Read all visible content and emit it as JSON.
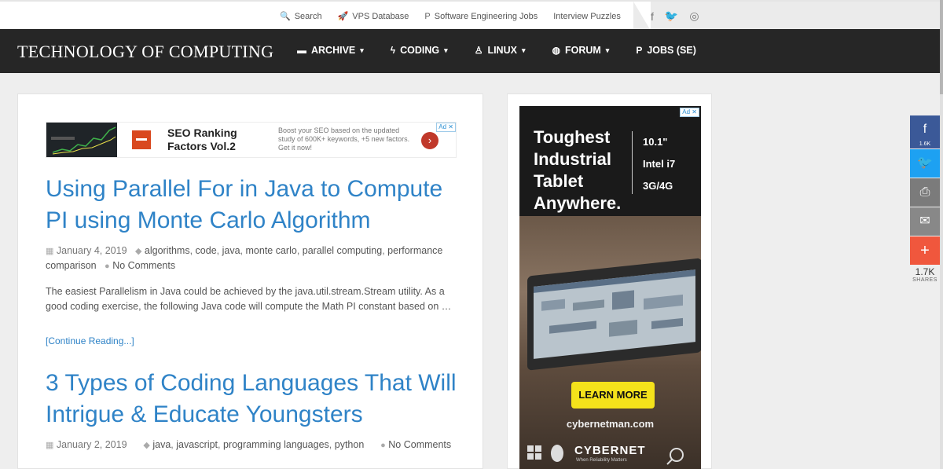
{
  "topbar": {
    "links": [
      {
        "icon": "search-icon",
        "glyph": "🔍",
        "label": "Search"
      },
      {
        "icon": "rocket-icon",
        "glyph": "🚀",
        "label": "VPS Database"
      },
      {
        "icon": "p-icon",
        "glyph": "P",
        "label": "Software Engineering Jobs"
      },
      {
        "icon": "none",
        "glyph": "",
        "label": "Interview Puzzles"
      }
    ],
    "social": [
      {
        "icon": "facebook-icon",
        "glyph": "f"
      },
      {
        "icon": "twitter-icon",
        "glyph": "🐦"
      },
      {
        "icon": "rss-icon",
        "glyph": "◎"
      }
    ]
  },
  "nav": {
    "brand": "TECHNOLOGY OF COMPUTING",
    "items": [
      {
        "icon": "archive-icon",
        "glyph": "▬",
        "label": "ARCHIVE"
      },
      {
        "icon": "bolt-icon",
        "glyph": "ϟ",
        "label": "CODING"
      },
      {
        "icon": "linux-icon",
        "glyph": "♙",
        "label": "LINUX"
      },
      {
        "icon": "forum-icon",
        "glyph": "◍",
        "label": "FORUM"
      },
      {
        "icon": "p-icon",
        "glyph": "P",
        "label": "JOBS (SE)"
      }
    ],
    "caret": "▾"
  },
  "ad_banner": {
    "title": "SEO Ranking Factors Vol.2",
    "desc": "Boost your SEO based on the updated study of 600K+ keywords, +5 new factors. Get it now!",
    "go": "›",
    "adchoice": "Ad ✕"
  },
  "posts": [
    {
      "title": "Using Parallel For in Java to Compute PI using Monte Carlo Algorithm",
      "date": "January 4, 2019",
      "tags": [
        "algorithms",
        "code",
        "java",
        "monte carlo",
        "parallel computing",
        "performance comparison"
      ],
      "comments": "No Comments",
      "excerpt": "The easiest Parallelism in Java could be achieved by the java.util.stream.Stream utility. As a good coding exercise, the following Java code will compute the Math PI constant based on …",
      "read_more": "[Continue Reading...]"
    },
    {
      "title": "3 Types of Coding Languages That Will Intrigue & Educate Youngsters",
      "date": "January 2, 2019",
      "tags": [
        "java",
        "javascript",
        "programming languages",
        "python"
      ],
      "comments": "No Comments"
    }
  ],
  "sidebar_ad": {
    "headline": "Toughest Industrial Tablet Anywhere.",
    "specs": [
      "10.1\"",
      "Intel i7",
      "3G/4G"
    ],
    "cta": "LEARN MORE",
    "site": "cybernetman.com",
    "brand": "CYBERNET",
    "slogan": "When Reliability Matters",
    "adchoice": "Ad ✕"
  },
  "share": {
    "facebook_count": "1.6K",
    "total": "1.7K",
    "label": "SHARES"
  },
  "colors": {
    "link": "#2f83c7",
    "nav_bg": "#262626",
    "facebook": "#3b5998",
    "twitter": "#1da1f2",
    "more": "#f0573d",
    "cta": "#f4e21b"
  }
}
